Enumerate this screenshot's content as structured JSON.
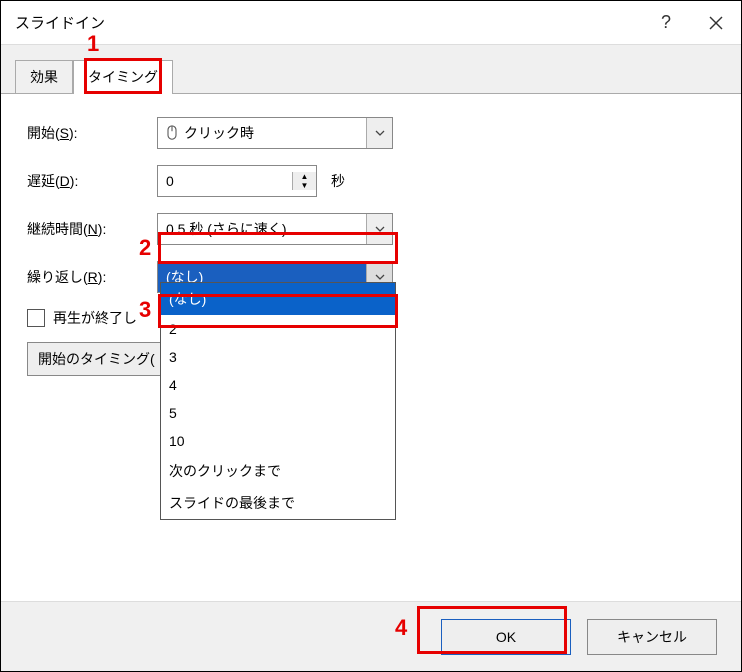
{
  "window": {
    "title": "スライドイン",
    "help_symbol": "?"
  },
  "tabs": {
    "effect": "効果",
    "timing": "タイミング"
  },
  "fields": {
    "start": {
      "label_pre": "開始(",
      "label_u": "S",
      "label_post": "):",
      "value": "クリック時"
    },
    "delay": {
      "label_pre": "遅延(",
      "label_u": "D",
      "label_post": "):",
      "value": "0",
      "unit": "秒"
    },
    "duration": {
      "label_pre": "継続時間(",
      "label_u": "N",
      "label_post": "):",
      "value": "0.5 秒 (さらに速く)"
    },
    "repeat": {
      "label_pre": "繰り返し(",
      "label_u": "R",
      "label_post": "):",
      "value": "(なし)"
    },
    "rewind": {
      "label": "再生が終了し"
    },
    "trigger_btn": "開始のタイミング("
  },
  "repeat_options": [
    "(なし)",
    "2",
    "3",
    "4",
    "5",
    "10",
    "次のクリックまで",
    "スライドの最後まで"
  ],
  "footer": {
    "ok": "OK",
    "cancel": "キャンセル"
  },
  "annotations": {
    "n1": "1",
    "n2": "2",
    "n3": "3",
    "n4": "4"
  }
}
